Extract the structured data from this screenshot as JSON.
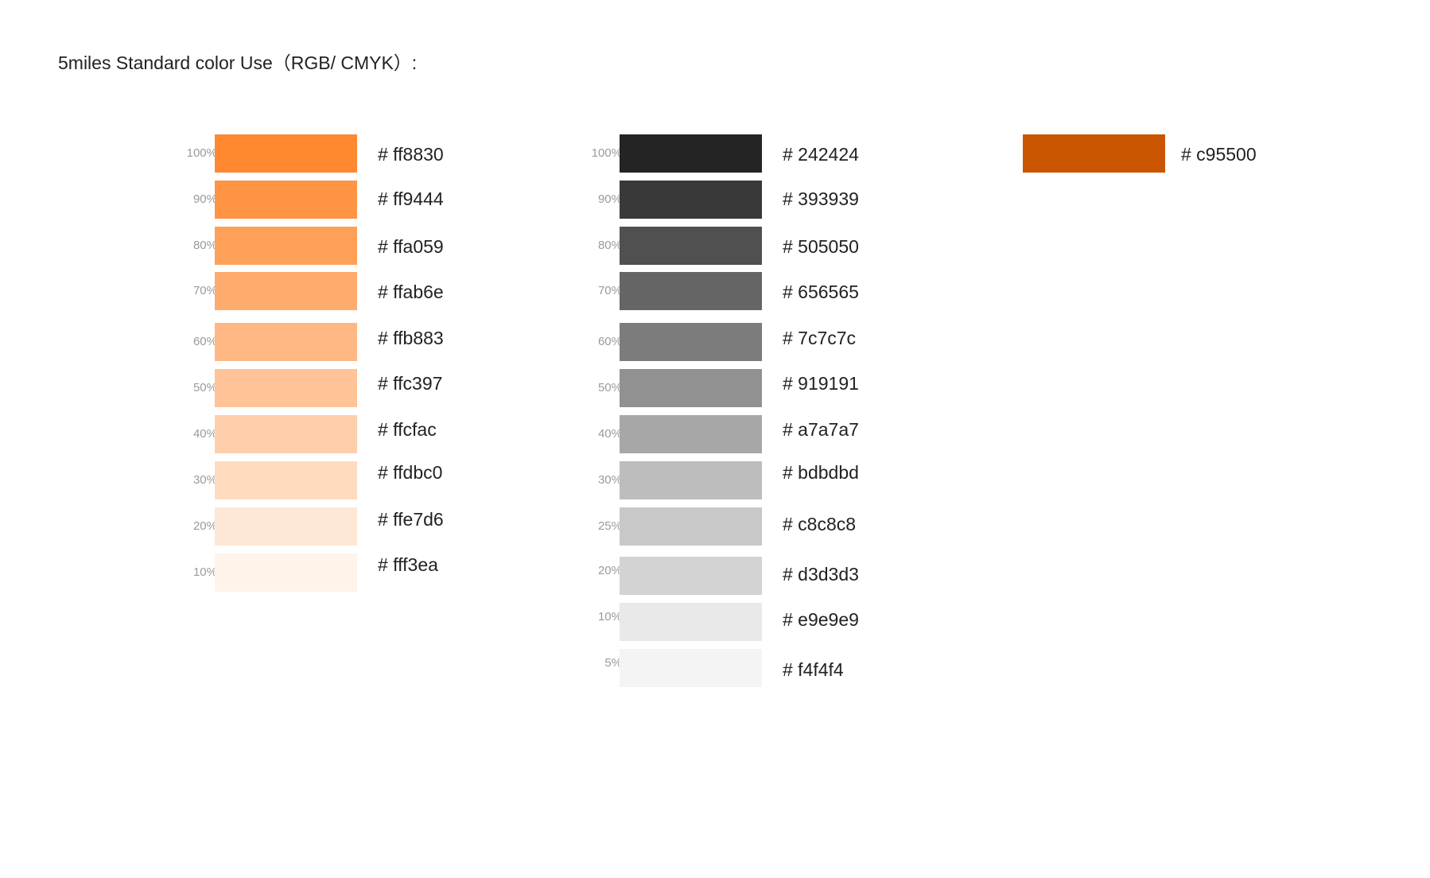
{
  "title": "5miles Standard color Use（RGB/ CMYK）:",
  "orange_palette": [
    {
      "percent": "100%",
      "hex_label": "# ff8830",
      "color": "#ff8830"
    },
    {
      "percent": "90%",
      "hex_label": "# ff9444",
      "color": "#ff9444"
    },
    {
      "percent": "80%",
      "hex_label": "# ffa059",
      "color": "#ffa059"
    },
    {
      "percent": "70%",
      "hex_label": "# ffab6e",
      "color": "#ffab6e"
    },
    {
      "percent": "60%",
      "hex_label": "# ffb883",
      "color": "#ffb883"
    },
    {
      "percent": "50%",
      "hex_label": "# ffc397",
      "color": "#ffc397"
    },
    {
      "percent": "40%",
      "hex_label": "# ffcfac",
      "color": "#ffcfac"
    },
    {
      "percent": "30%",
      "hex_label": "# ffdbc0",
      "color": "#ffdbc0"
    },
    {
      "percent": "20%",
      "hex_label": "# ffe7d6",
      "color": "#ffe7d6"
    },
    {
      "percent": "10%",
      "hex_label": "# fff3ea",
      "color": "#fff3ea"
    }
  ],
  "gray_palette": [
    {
      "percent": "100%",
      "hex_label": "# 242424",
      "color": "#242424"
    },
    {
      "percent": "90%",
      "hex_label": "# 393939",
      "color": "#393939"
    },
    {
      "percent": "80%",
      "hex_label": "# 505050",
      "color": "#505050"
    },
    {
      "percent": "70%",
      "hex_label": "# 656565",
      "color": "#656565"
    },
    {
      "percent": "60%",
      "hex_label": "# 7c7c7c",
      "color": "#7c7c7c"
    },
    {
      "percent": "50%",
      "hex_label": "# 919191",
      "color": "#919191"
    },
    {
      "percent": "40%",
      "hex_label": "# a7a7a7",
      "color": "#a7a7a7"
    },
    {
      "percent": "30%",
      "hex_label": "# bdbdbd",
      "color": "#bdbdbd"
    },
    {
      "percent": "25%",
      "hex_label": "# c8c8c8",
      "color": "#c8c8c8"
    },
    {
      "percent": "20%",
      "hex_label": "# d3d3d3",
      "color": "#d3d3d3"
    },
    {
      "percent": "10%",
      "hex_label": "# e9e9e9",
      "color": "#e9e9e9"
    },
    {
      "percent": "5%",
      "hex_label": "# f4f4f4",
      "color": "#f4f4f4"
    }
  ],
  "accent": {
    "hex_label": "# c95500",
    "color": "#c95500"
  }
}
